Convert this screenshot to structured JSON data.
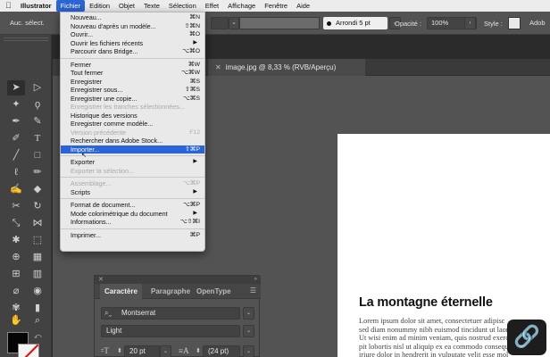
{
  "menubar": {
    "apple": "",
    "items": [
      "Illustrator",
      "Fichier",
      "Edition",
      "Objet",
      "Texte",
      "Sélection",
      "Effet",
      "Affichage",
      "Fenêtre",
      "Aide"
    ],
    "active_index": 1
  },
  "controlbar": {
    "selection_state": "Auc. sélect.",
    "brush": "Arrondi 5 pt",
    "opacity_label": "Opacité :",
    "opacity_value": "100%",
    "style_label": "Style :",
    "right_label": "Adob"
  },
  "document": {
    "tab_label": "image.jpg @ 8,33 % (RVB/Aperçu)"
  },
  "artboard": {
    "title": "La montagne éternelle",
    "body_lines": [
      "Lorem ipsum dolor sit amet, consectetuer adipisc",
      "sed diam nonummy nibh euismod tincidunt ut laoreet dolore m",
      "Ut wisi enim ad minim veniam, quis nostrud exerci tation ul",
      "pit lobortis nisl ut aliquip ex ea commodo consequat. D",
      "iriure dolor in hendrerit in vulputate velit esse mol"
    ]
  },
  "character_panel": {
    "tabs": [
      "Caractère",
      "Paragraphe",
      "OpenType"
    ],
    "font_family": "Montserrat",
    "font_style": "Light",
    "font_size": "20 pt",
    "leading": "(24 pt)"
  },
  "file_menu": {
    "groups": [
      [
        {
          "label": "Nouveau...",
          "shortcut": "⌘N"
        },
        {
          "label": "Nouveau d'après un modèle...",
          "shortcut": "⇧⌘N"
        },
        {
          "label": "Ouvrir...",
          "shortcut": "⌘O"
        },
        {
          "label": "Ouvrir les fichiers récents",
          "arrow": "▶"
        },
        {
          "label": "Parcourir dans Bridge...",
          "shortcut": "⌥⌘O"
        }
      ],
      [
        {
          "label": "Fermer",
          "shortcut": "⌘W"
        },
        {
          "label": "Tout fermer",
          "shortcut": "⌥⌘W"
        },
        {
          "label": "Enregistrer",
          "shortcut": "⌘S"
        },
        {
          "label": "Enregistrer sous...",
          "shortcut": "⇧⌘S"
        },
        {
          "label": "Enregistrer une copie...",
          "shortcut": "⌥⌘S"
        },
        {
          "label": "Enregistrer les tranches sélectionnées...",
          "disabled": true
        },
        {
          "label": "Historique des versions"
        },
        {
          "label": "Enregistrer comme modèle..."
        },
        {
          "label": "Version précédente",
          "shortcut": "F12",
          "disabled": true
        },
        {
          "label": "Rechercher dans Adobe Stock..."
        },
        {
          "label": "Importer...",
          "shortcut": "⇧⌘P",
          "highlighted": true
        }
      ],
      [
        {
          "label": "Exporter",
          "arrow": "▶"
        },
        {
          "label": "Exporter la sélection...",
          "disabled": true
        }
      ],
      [
        {
          "label": "Assemblage...",
          "shortcut": "⌥⌘P",
          "disabled": true
        },
        {
          "label": "Scripts",
          "arrow": "▶"
        }
      ],
      [
        {
          "label": "Format de document...",
          "shortcut": "⌥⌘P"
        },
        {
          "label": "Mode colorimétrique du document",
          "arrow": "▶"
        },
        {
          "label": "Informations...",
          "shortcut": "⌥⇧⌘I"
        }
      ],
      [
        {
          "label": "Imprimer...",
          "shortcut": "⌘P"
        }
      ]
    ]
  },
  "colors": {
    "menu_highlight": "#2a64d6",
    "ui_background": "#535353",
    "fill_swatch": "#050505",
    "stroke_swatch": "#f4f4f4"
  },
  "icons": {
    "link": "link-icon"
  }
}
